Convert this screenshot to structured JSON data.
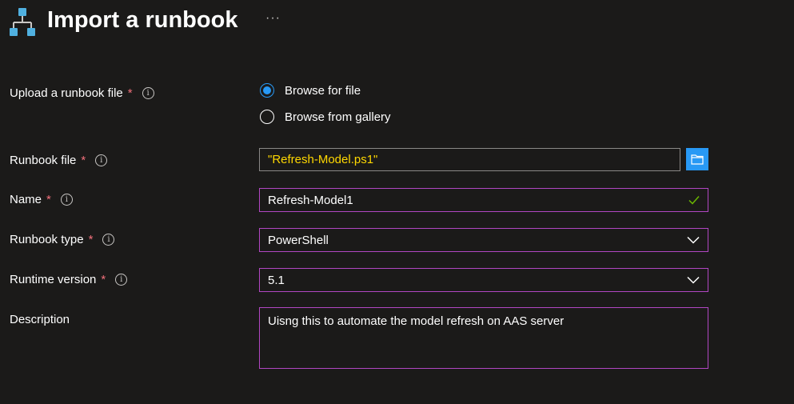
{
  "header": {
    "title": "Import a runbook",
    "more_label": "···",
    "icon": "runbook-hierarchy-icon"
  },
  "form": {
    "upload": {
      "label": "Upload a runbook file",
      "required_mark": "*",
      "options": [
        {
          "label": "Browse for file",
          "selected": true
        },
        {
          "label": "Browse from gallery",
          "selected": false
        }
      ]
    },
    "runbook_file": {
      "label": "Runbook file",
      "required_mark": "*",
      "value": "\"Refresh-Model.ps1\"",
      "button_icon": "folder-icon"
    },
    "name": {
      "label": "Name",
      "required_mark": "*",
      "value": "Refresh-Model1",
      "status_icon": "checkmark-icon"
    },
    "runbook_type": {
      "label": "Runbook type",
      "required_mark": "*",
      "value": "PowerShell"
    },
    "runtime_version": {
      "label": "Runtime version",
      "required_mark": "*",
      "value": "5.1"
    },
    "description": {
      "label": "Description",
      "value": "Uisng this to automate the model refresh on AAS server"
    }
  },
  "colors": {
    "background": "#1b1a19",
    "accent": "#2899f5",
    "focus_border": "#b146c2",
    "required": "#f1707b",
    "valid": "#6bb700",
    "file_text": "#ffd800"
  }
}
